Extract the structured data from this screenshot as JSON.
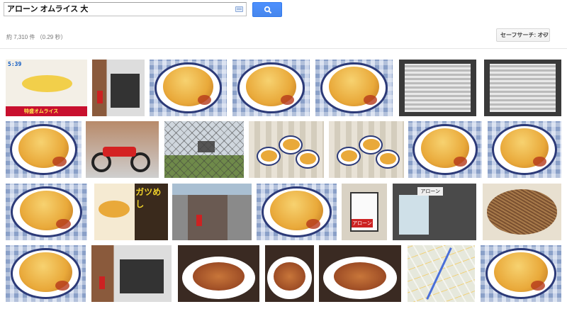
{
  "search": {
    "query": "アローン オムライス 大",
    "keyboard_icon": "keyboard-icon",
    "button_icon": "magnifier-icon"
  },
  "toolbar": {
    "result_stats": "約 7,310 件 （0.29 秒）",
    "safe_search_label": "セーフサーチ: オフ"
  },
  "colors": {
    "search_button": "#4d90fe",
    "egg": "#e9a93a",
    "sauce": "#b53a1c",
    "plate_rim": "#2c3a78",
    "tablecloth": "#8aa0c8"
  },
  "results": [
    {
      "row": 1,
      "subject": "tv-show-omurice",
      "caption": "5:39",
      "overlay_text": "特盛オムライス"
    },
    {
      "row": 1,
      "subject": "storefront"
    },
    {
      "row": 1,
      "subject": "omurice-plate"
    },
    {
      "row": 1,
      "subject": "omurice-plate"
    },
    {
      "row": 1,
      "subject": "omurice-plate"
    },
    {
      "row": 1,
      "subject": "menu-board"
    },
    {
      "row": 1,
      "subject": "menu-board"
    },
    {
      "row": 2,
      "subject": "omurice-plate"
    },
    {
      "row": 2,
      "subject": "red-motorcycle"
    },
    {
      "row": 2,
      "subject": "castle-through-fence"
    },
    {
      "row": 2,
      "subject": "table-with-dishes"
    },
    {
      "row": 2,
      "subject": "table-with-dishes"
    },
    {
      "row": 2,
      "subject": "omurice-plate"
    },
    {
      "row": 2,
      "subject": "omurice-plate"
    },
    {
      "row": 3,
      "subject": "omurice-plate"
    },
    {
      "row": 3,
      "subject": "magazine-page",
      "overlay_text": "ガツめし"
    },
    {
      "row": 3,
      "subject": "building-street"
    },
    {
      "row": 3,
      "subject": "omurice-plate"
    },
    {
      "row": 3,
      "subject": "shop-sign",
      "overlay_text": "アローン"
    },
    {
      "row": 3,
      "subject": "shop-entrance",
      "overlay_text": "アローン"
    },
    {
      "row": 3,
      "subject": "noodle-dish"
    },
    {
      "row": 4,
      "subject": "omurice-closeup"
    },
    {
      "row": 4,
      "subject": "storefront"
    },
    {
      "row": 4,
      "subject": "cutlet-plate"
    },
    {
      "row": 4,
      "subject": "cutlet-plate"
    },
    {
      "row": 4,
      "subject": "cutlet-plate"
    },
    {
      "row": 4,
      "subject": "street-map"
    },
    {
      "row": 4,
      "subject": "omurice-plate"
    }
  ]
}
